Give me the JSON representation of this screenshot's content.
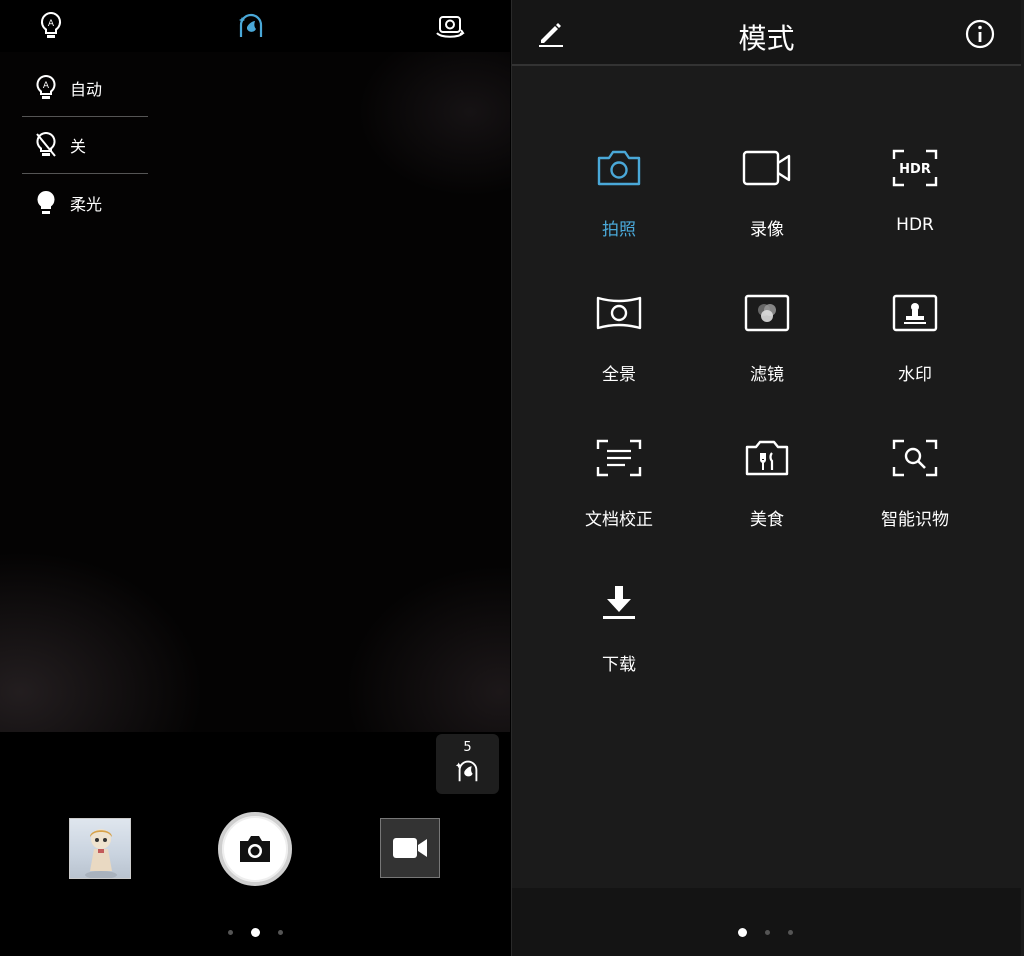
{
  "camera": {
    "flash_menu": [
      {
        "label": "自动",
        "icon": "flash-auto-icon"
      },
      {
        "label": "关",
        "icon": "flash-off-icon"
      },
      {
        "label": "柔光",
        "icon": "flash-soft-icon"
      }
    ],
    "beauty_level": "5",
    "page_dots": 3,
    "active_page": 2
  },
  "mode_panel": {
    "title": "模式",
    "modes": [
      {
        "label": "拍照",
        "icon": "camera-icon",
        "active": true
      },
      {
        "label": "录像",
        "icon": "video-icon",
        "active": false
      },
      {
        "label": "HDR",
        "icon": "hdr-icon",
        "active": false
      },
      {
        "label": "全景",
        "icon": "panorama-icon",
        "active": false
      },
      {
        "label": "滤镜",
        "icon": "filter-icon",
        "active": false
      },
      {
        "label": "水印",
        "icon": "watermark-icon",
        "active": false
      },
      {
        "label": "文档校正",
        "icon": "document-icon",
        "active": false
      },
      {
        "label": "美食",
        "icon": "food-icon",
        "active": false
      },
      {
        "label": "智能识物",
        "icon": "object-search-icon",
        "active": false
      },
      {
        "label": "下载",
        "icon": "download-icon",
        "active": false
      }
    ],
    "page_dots": 3,
    "active_page": 1
  },
  "colors": {
    "accent": "#4aa8d8",
    "panel_bg": "#1b1b1b"
  }
}
